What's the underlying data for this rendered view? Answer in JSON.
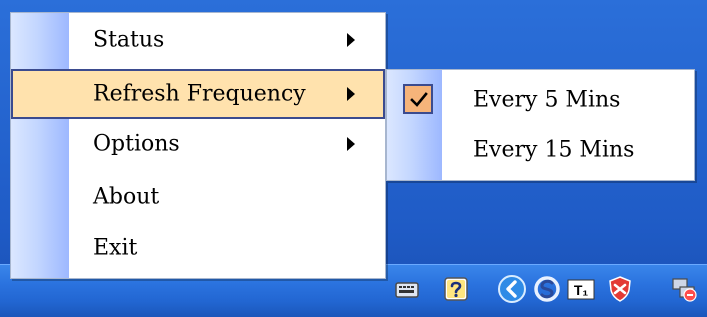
{
  "menu": {
    "items": [
      {
        "label": "Status",
        "has_submenu": true,
        "active": false
      },
      {
        "label": "Refresh Frequency",
        "has_submenu": true,
        "active": true
      },
      {
        "label": "Options",
        "has_submenu": true,
        "active": false
      },
      {
        "label": "About",
        "has_submenu": false,
        "active": false
      },
      {
        "label": "Exit",
        "has_submenu": false,
        "active": false
      }
    ]
  },
  "submenu": {
    "items": [
      {
        "label": "Every 5 Mins",
        "checked": true
      },
      {
        "label": "Every 15 Mins",
        "checked": false
      }
    ]
  },
  "tray": {
    "icons": [
      "keyboard-icon",
      "help-icon",
      "back-arrow-icon",
      "sync-icon",
      "t1-icon",
      "security-shield-icon",
      "network-icon"
    ],
    "t1_icon_text": "T₁"
  },
  "colors": {
    "highlight": "#ffe2ad",
    "highlight_border": "#3b4b8f",
    "checkbox_fill": "#f6b47a",
    "gutter_blue": "#9db8ff",
    "taskbar_blue": "#2b73df"
  }
}
